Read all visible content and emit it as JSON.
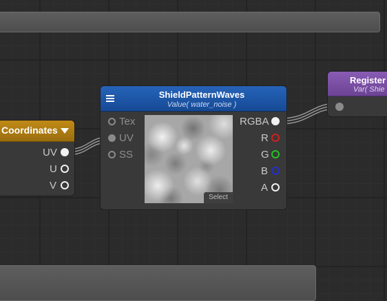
{
  "coord_node": {
    "title": "Coordinates",
    "outputs": [
      "UV",
      "U",
      "V"
    ]
  },
  "main_node": {
    "title": "ShieldPatternWaves",
    "subtitle": "Value( water_noise )",
    "inputs": [
      "Tex",
      "UV",
      "SS"
    ],
    "outputs": [
      "RGBA",
      "R",
      "G",
      "B",
      "A"
    ],
    "preview_button": "Select"
  },
  "register_node": {
    "title": "Register",
    "subtitle": "Var( Shie"
  },
  "colors": {
    "header_blue": "#1d56a8",
    "header_gold": "#b07e12",
    "header_purple": "#7b4fa3",
    "port_red": "#d21f1f",
    "port_green": "#21c521",
    "port_blue": "#2430c8"
  }
}
